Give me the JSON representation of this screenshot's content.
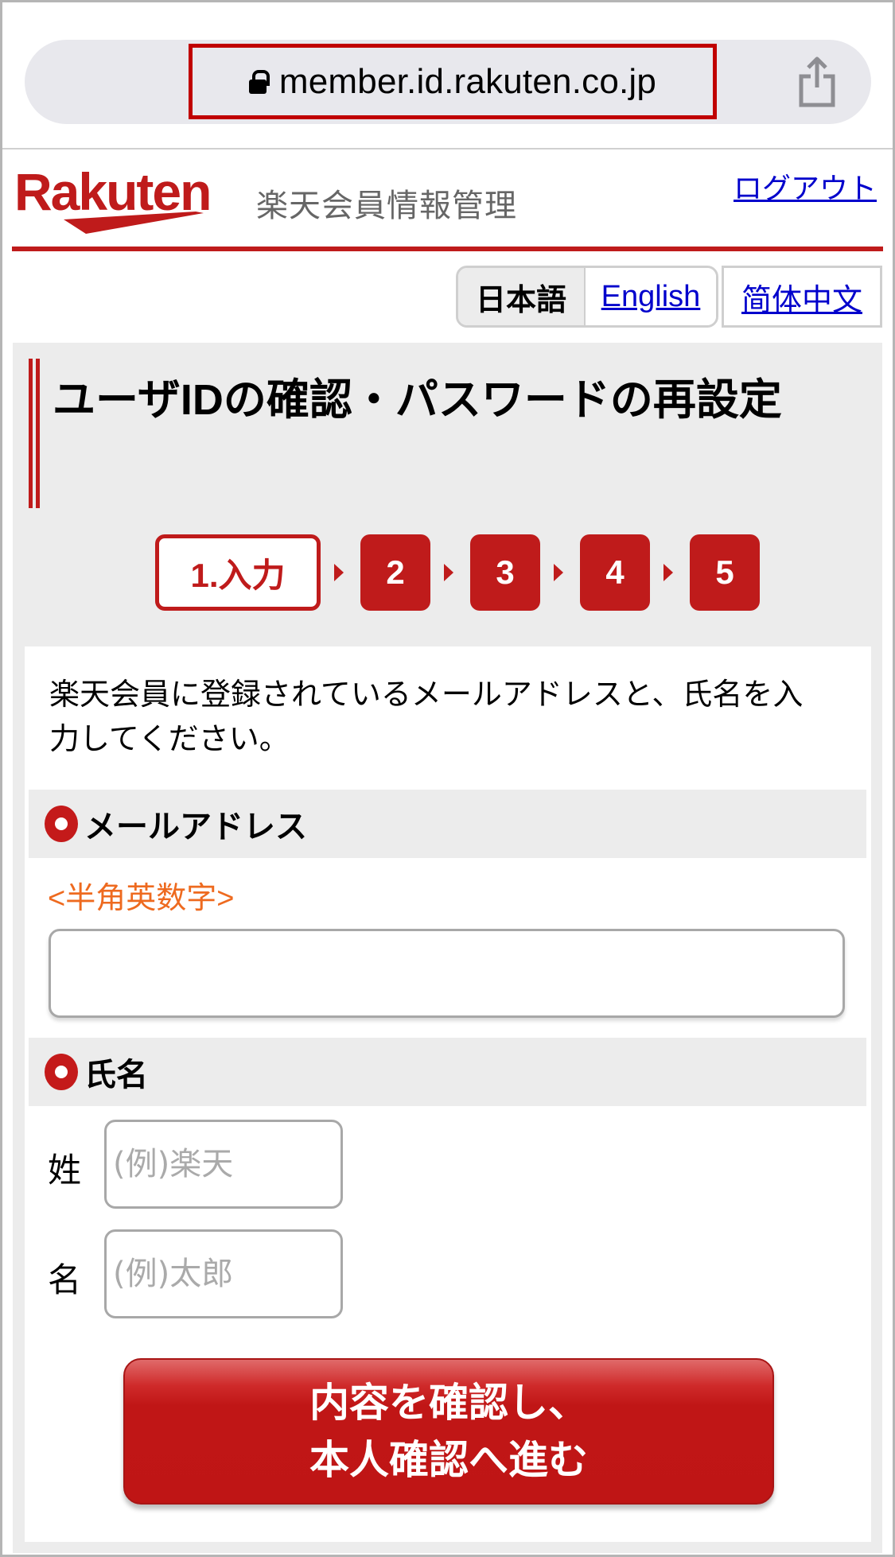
{
  "browser": {
    "url": "member.id.rakuten.co.jp",
    "lock_icon": "lock-icon",
    "share_icon": "share-icon",
    "highlight_color": "#c00000"
  },
  "header": {
    "logo_text": "Rakuten",
    "site_title": "楽天会員情報管理",
    "logout_label": "ログアウト",
    "brand_color": "#bf1b1b"
  },
  "languages": {
    "items": [
      {
        "label": "日本語",
        "selected": true
      },
      {
        "label": "English",
        "selected": false
      },
      {
        "label": "简体中文",
        "selected": false
      }
    ]
  },
  "page": {
    "title": "ユーザIDの確認・パスワードの再設定"
  },
  "steps": {
    "current": 1,
    "items": [
      {
        "label": "1.入力",
        "active": true
      },
      {
        "label": "2",
        "active": false
      },
      {
        "label": "3",
        "active": false
      },
      {
        "label": "4",
        "active": false
      },
      {
        "label": "5",
        "active": false
      }
    ]
  },
  "form": {
    "intro": "楽天会員に登録されているメールアドレスと、氏名を入力してください。",
    "email": {
      "label": "メールアドレス",
      "hint": "<半角英数字>",
      "value": "",
      "required_icon": "required-icon"
    },
    "name": {
      "label": "氏名",
      "required_icon": "required-icon",
      "last_name": {
        "label": "姓",
        "placeholder": "(例)楽天",
        "value": ""
      },
      "first_name": {
        "label": "名",
        "placeholder": "(例)太郎",
        "value": ""
      }
    },
    "submit": {
      "line1": "内容を確認し、",
      "line2": "本人確認へ進む"
    },
    "hint_color": "#ee6a1f"
  }
}
